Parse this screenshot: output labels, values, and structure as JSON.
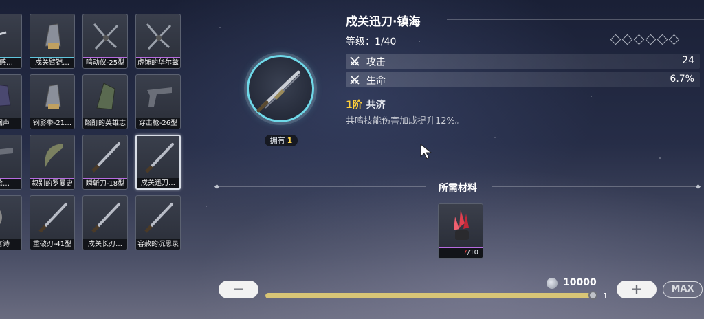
{
  "inventory": {
    "items": [
      {
        "name": "回音感…",
        "rarity": "cyan",
        "art": "claw"
      },
      {
        "name": "戍关臂铠…",
        "rarity": "cyan",
        "art": "gauntlet"
      },
      {
        "name": "鸣动仪-25型",
        "rarity": "purple",
        "art": "blades"
      },
      {
        "name": "虚饰的华尔兹",
        "rarity": "purple",
        "art": "blades"
      },
      {
        "name": "海回声",
        "rarity": "purple",
        "art": "glove"
      },
      {
        "name": "钢影拳-21…",
        "rarity": "purple",
        "art": "gauntlet"
      },
      {
        "name": "酩酊的英雄志",
        "rarity": "purple",
        "art": "fist"
      },
      {
        "name": "穿击枪-26型",
        "rarity": "purple",
        "art": "pistol"
      },
      {
        "name": "佩枪…",
        "rarity": "purple",
        "art": "pistol"
      },
      {
        "name": "叙别的罗曼史",
        "rarity": "purple",
        "art": "sickle"
      },
      {
        "name": "瞬斩刀-18型",
        "rarity": "purple",
        "art": "sword"
      },
      {
        "name": "戍关迅刀…",
        "rarity": "cyan",
        "art": "sword",
        "selected": true
      },
      {
        "name": "寓言诗",
        "rarity": "purple",
        "art": "bow"
      },
      {
        "name": "重破刃-41型",
        "rarity": "purple",
        "art": "sword"
      },
      {
        "name": "戍关长刃…",
        "rarity": "cyan",
        "art": "sword"
      },
      {
        "name": "容赦的沉思录",
        "rarity": "purple",
        "art": "sword"
      }
    ]
  },
  "detail": {
    "title": "戍关迅刀·镇海",
    "level_text": "等级：1/40",
    "owned_label": "拥有",
    "owned_count": "1",
    "stats": [
      {
        "label": "攻击",
        "value": "24",
        "icon": "crossed-swords-icon"
      },
      {
        "label": "生命",
        "value": "6.7%",
        "icon": "crossed-swords-icon"
      }
    ],
    "resonance_rank": "1阶",
    "resonance_name": "共济",
    "resonance_desc": "共鸣技能伤害加成提升12%。"
  },
  "materials": {
    "title": "所需材料",
    "item_count_have": "7",
    "item_count_need": "/10",
    "item_icon": "red-crystal-icon"
  },
  "control": {
    "minus": "−",
    "plus": "+",
    "max": "MAX",
    "cost": "10000",
    "slider_value": "1",
    "slider_fraction": 0.99
  },
  "colors": {
    "accent_cyan": "#6fd8e8",
    "rarity_purple": "#b66be0",
    "gold": "#ffcf3a"
  }
}
